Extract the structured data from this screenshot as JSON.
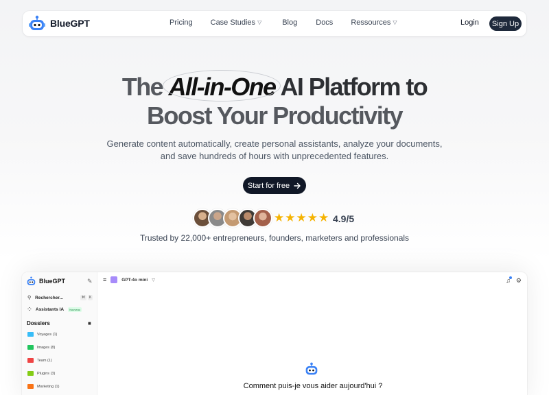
{
  "nav": {
    "brand": "BlueGPT",
    "links": [
      {
        "label": "Pricing",
        "dropdown": false
      },
      {
        "label": "Case Studies",
        "dropdown": true
      },
      {
        "label": "Blog",
        "dropdown": false
      },
      {
        "label": "Docs",
        "dropdown": false
      },
      {
        "label": "Ressources",
        "dropdown": true
      }
    ],
    "login": "Login",
    "signup": "Sign Up"
  },
  "hero": {
    "title_pre": "The",
    "title_em": "All-in-One",
    "title_post": "AI Platform to",
    "title_line2": "Boost Your Productivity",
    "subtitle": "Generate content automatically, create personal assistants, analyze your documents, and save hundreds of hours with unprecedented features.",
    "cta": "Start for free",
    "rating": "4.9/5",
    "stars": 5,
    "trusted": "Trusted by 22,000+ entrepreneurs, founders, marketers and professionals"
  },
  "colors": {
    "brand_blue": "#3b82f6",
    "dark_button": "#1e293b",
    "star": "#f5b301",
    "avatars": [
      "#6b4f3a",
      "#8a8a8a",
      "#c49a72",
      "#3f3a36",
      "#a3604a"
    ]
  },
  "app": {
    "brand": "BlueGPT",
    "search": "Rechercher...",
    "shortcut": [
      "⌘",
      "K"
    ],
    "assistants": "Assistants IA",
    "assistants_badge": "Nouveau",
    "folders_heading": "Dossiers",
    "folders": [
      {
        "label": "Voyages (1)",
        "color": "#38bdf8"
      },
      {
        "label": "Images (8)",
        "color": "#22c55e"
      },
      {
        "label": "Team (1)",
        "color": "#ef4444"
      },
      {
        "label": "Plugins (3)",
        "color": "#84cc16"
      },
      {
        "label": "Marketing (1)",
        "color": "#f97316"
      }
    ],
    "model": "GPT-4o mini",
    "prompt": "Comment puis-je vous aider aujourd'hui ?"
  }
}
